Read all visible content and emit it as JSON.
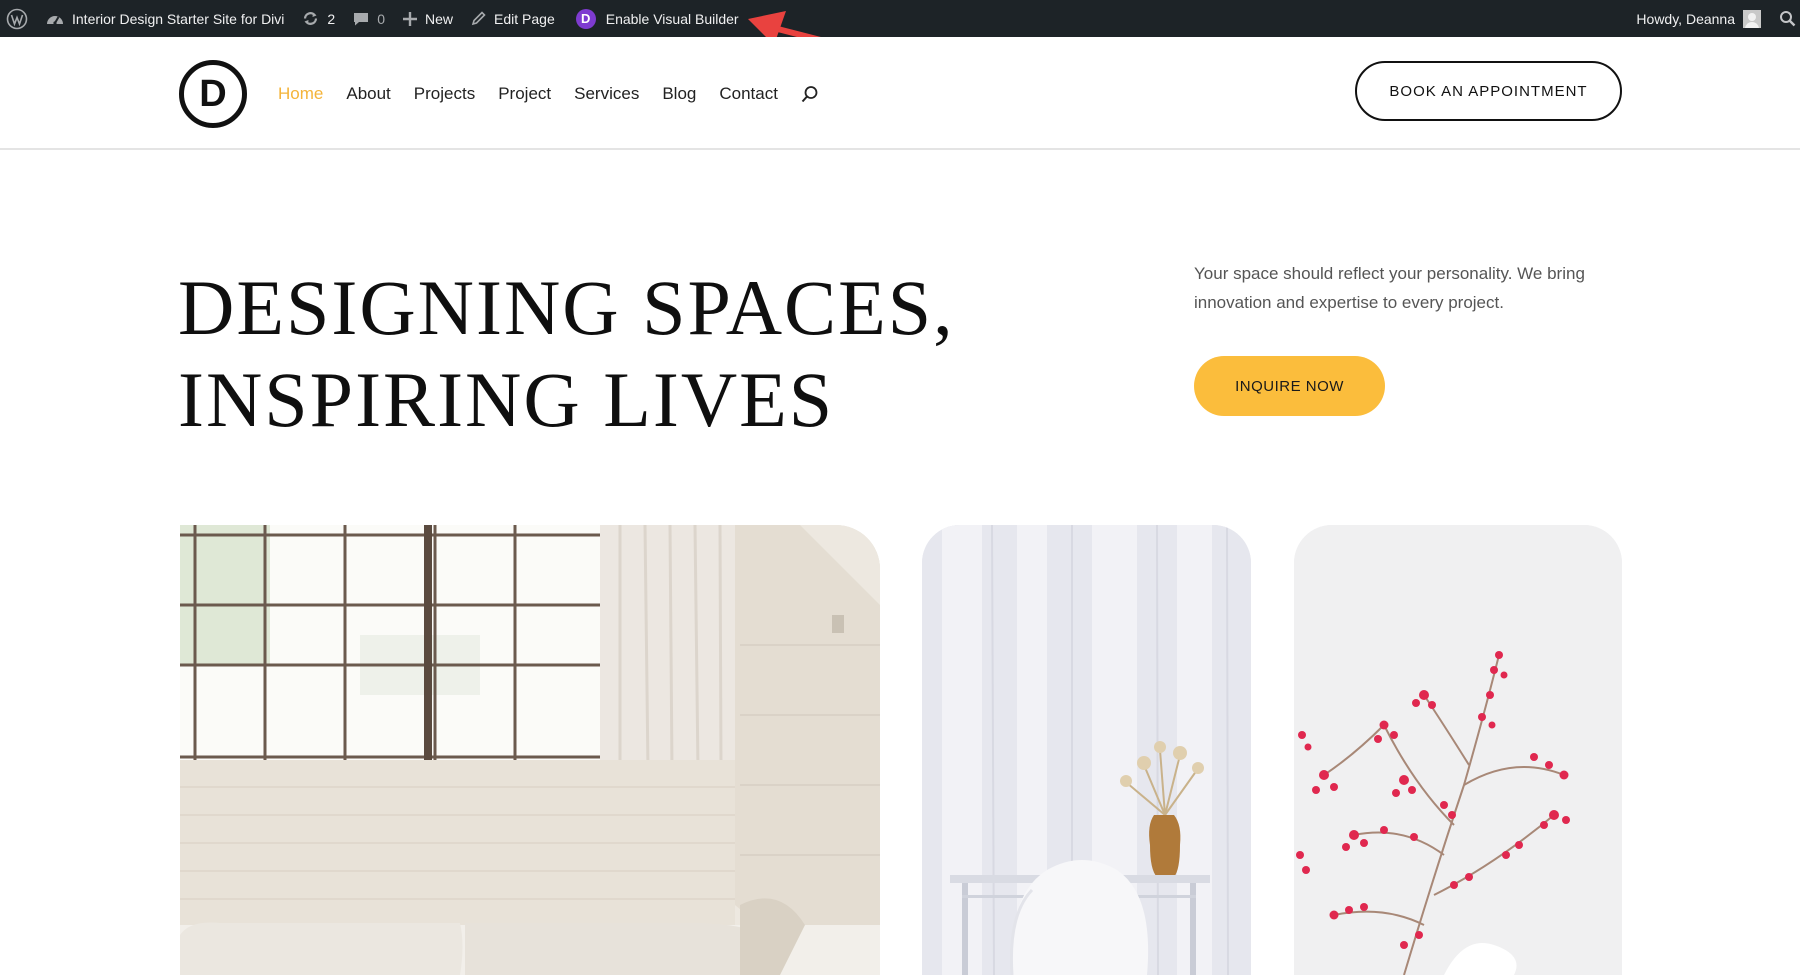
{
  "admin_bar": {
    "site_name": "Interior Design Starter Site for Divi",
    "updates_count": "2",
    "comments_count": "0",
    "new_label": "New",
    "edit_page_label": "Edit Page",
    "visual_builder_label": "Enable Visual Builder",
    "greeting": "Howdy, Deanna"
  },
  "header": {
    "logo_letter": "D",
    "nav": [
      "Home",
      "About",
      "Projects",
      "Project",
      "Services",
      "Blog",
      "Contact"
    ],
    "active_nav": "Home",
    "cta_label": "BOOK AN APPOINTMENT"
  },
  "hero": {
    "title_line1": "DESIGNING SPACES,",
    "title_line2": "INSPIRING LIVES",
    "copy": "Your space should reflect your personality. We bring innovation and expertise to every project.",
    "cta_label": "INQUIRE NOW"
  },
  "colors": {
    "admin_bar_bg": "#1d2327",
    "accent": "#fbbd3c",
    "active_link": "#f4b43a",
    "divi_purple": "#7e3bd0",
    "annotation_red": "#e9423f"
  },
  "icons": [
    "wordpress-icon",
    "dashboard-icon",
    "updates-icon",
    "comments-icon",
    "plus-icon",
    "pencil-icon",
    "divi-icon",
    "avatar",
    "search-icon"
  ]
}
